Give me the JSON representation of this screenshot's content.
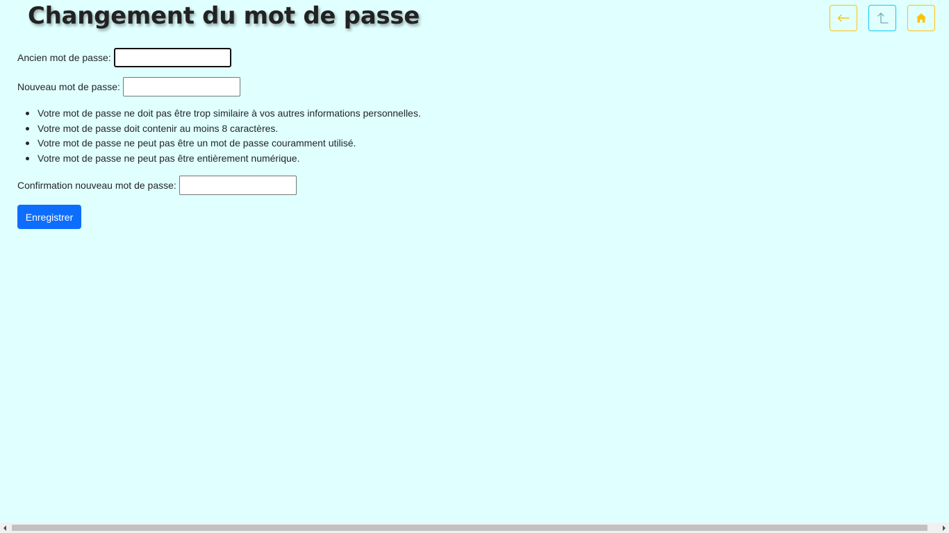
{
  "page": {
    "title": "Changement du mot de passe",
    "background_color": "#e0ffff"
  },
  "nav": {
    "back_icon": "arrow-left-icon",
    "up_icon": "arrow-up-icon",
    "home_icon": "home-icon",
    "warning_color": "#ffc107",
    "info_color": "#0dcaf0"
  },
  "form": {
    "old_password_label": "Ancien mot de passe:",
    "old_password_value": "",
    "new_password_label": "Nouveau mot de passe:",
    "new_password_value": "",
    "rules": [
      "Votre mot de passe ne doit pas être trop similaire à vos autres informations personnelles.",
      "Votre mot de passe doit contenir au moins 8 caractères.",
      "Votre mot de passe ne peut pas être un mot de passe couramment utilisé.",
      "Votre mot de passe ne peut pas être entièrement numérique."
    ],
    "confirm_password_label": "Confirmation nouveau mot de passe:",
    "confirm_password_value": "",
    "submit_label": "Enregistrer",
    "submit_color": "#0d6efd"
  }
}
